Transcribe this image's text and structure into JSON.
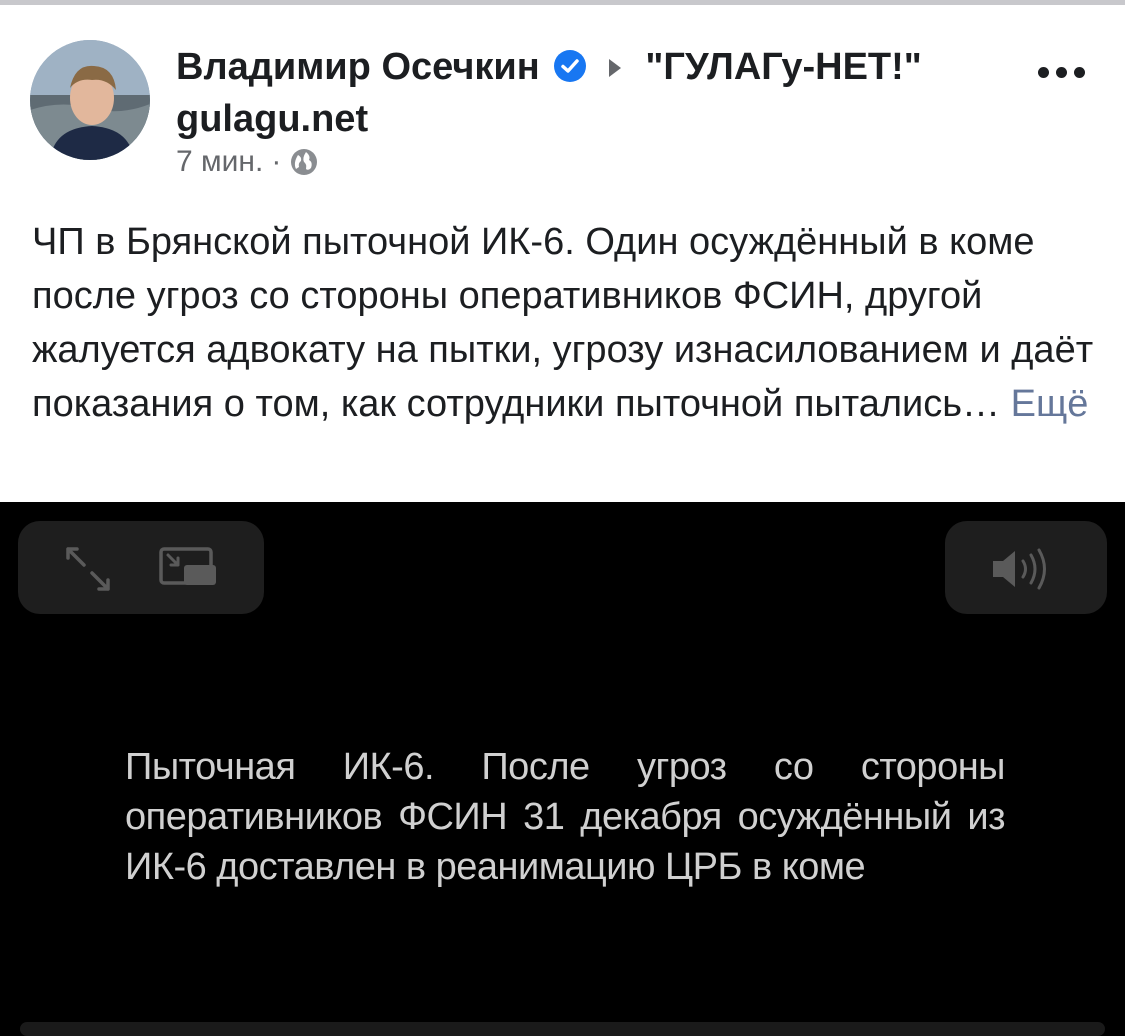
{
  "post": {
    "author": "Владимир Осечкин",
    "group": "\"ГУЛАГу-НЕТ!\" gulagu.net",
    "time": "7 мин.",
    "separator": "·",
    "text": "ЧП в Брянской пыточной ИК-6. Один осуждённый в коме после угроз со стороны оперативников ФСИН, другой жалуется адвокату на пытки, угрозу изнасилованием и даёт показания о том, как сотрудники пыточной пытались…",
    "see_more": "Ещё",
    "icons": {
      "verified": "verified-badge-icon",
      "privacy": "globe-icon",
      "more": "more-options-icon"
    }
  },
  "video": {
    "caption": "Пыточная ИК-6. После угроз со стороны оперативников ФСИН 31 декабря осуждённый из ИК-6 доставлен в реанимацию ЦРБ в коме",
    "icons": {
      "fullscreen": "expand-icon",
      "pip": "picture-in-picture-icon",
      "sound": "volume-icon"
    }
  },
  "colors": {
    "link": "#65779a",
    "verified": "#1877f2",
    "video_bg": "#000000"
  }
}
